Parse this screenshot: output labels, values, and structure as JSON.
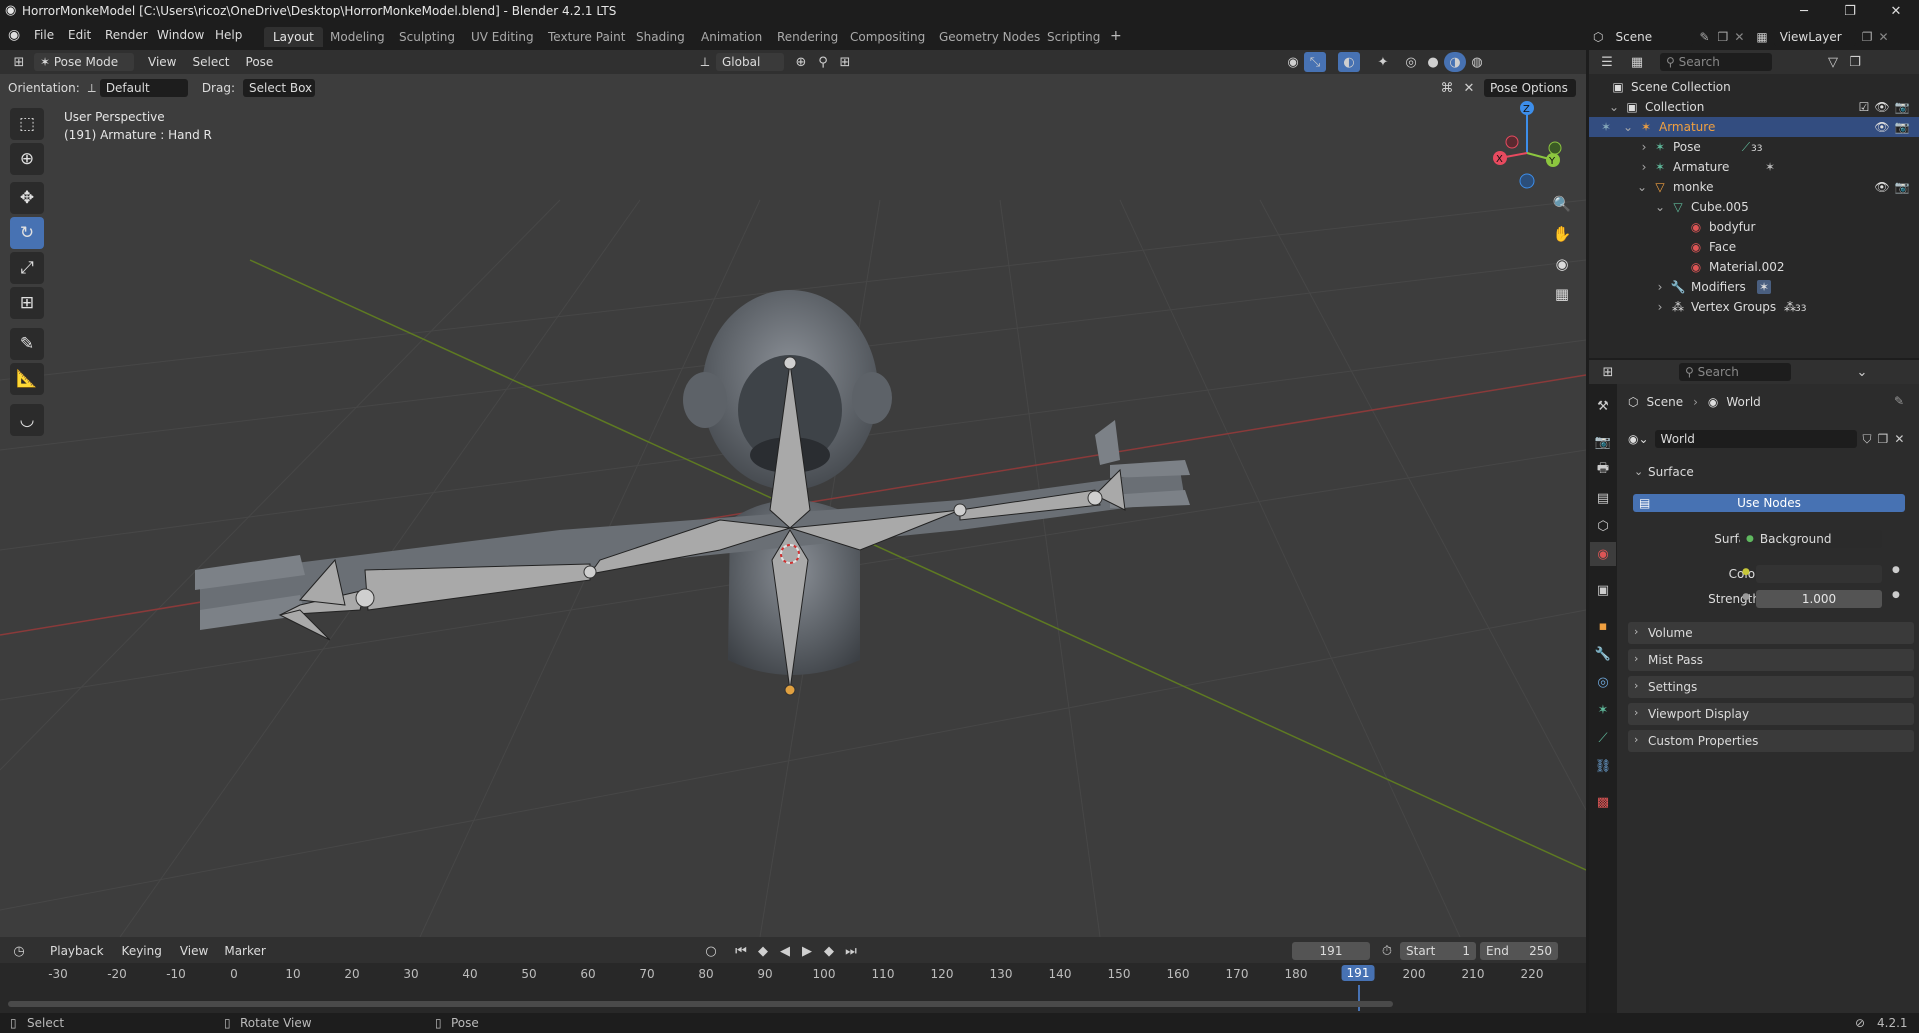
{
  "window": {
    "title": "HorrorMonkeModel [C:\\Users\\ricoz\\OneDrive\\Desktop\\HorrorMonkeModel.blend] - Blender 4.2.1 LTS",
    "minimize": "─",
    "maximize": "❐",
    "close": "✕"
  },
  "menu": {
    "file": "File",
    "edit": "Edit",
    "render": "Render",
    "window": "Window",
    "help": "Help"
  },
  "workspaces": [
    "Layout",
    "Modeling",
    "Sculpting",
    "UV Editing",
    "Texture Paint",
    "Shading",
    "Animation",
    "Rendering",
    "Compositing",
    "Geometry Nodes",
    "Scripting"
  ],
  "topright": {
    "scene": "Scene",
    "viewlayer": "ViewLayer"
  },
  "viewport_header": {
    "mode": "Pose Mode",
    "view": "View",
    "select": "Select",
    "pose": "Pose",
    "transform_orientation": "Global",
    "orientation_label": "Orientation:",
    "orientation_value": "Default",
    "drag_label": "Drag:",
    "drag_value": "Select Box",
    "pose_options": "Pose Options"
  },
  "viewport_overlay": {
    "perspective": "User Perspective",
    "object_info": "(191) Armature : Hand R"
  },
  "gizmo": {
    "x": "X",
    "y": "Y",
    "z": "Z"
  },
  "outliner": {
    "search_placeholder": "Search",
    "rows": [
      {
        "label": "Scene Collection"
      },
      {
        "label": "Collection"
      },
      {
        "label": "Armature"
      },
      {
        "label": "Pose",
        "badge": "33"
      },
      {
        "label": "Armature"
      },
      {
        "label": "monke"
      },
      {
        "label": "Cube.005"
      },
      {
        "label": "bodyfur"
      },
      {
        "label": "Face"
      },
      {
        "label": "Material.002"
      },
      {
        "label": "Modifiers"
      },
      {
        "label": "Vertex Groups",
        "badge": "33"
      }
    ]
  },
  "properties": {
    "search_placeholder": "Search",
    "breadcrumb_scene": "Scene",
    "breadcrumb_world": "World",
    "world_name": "World",
    "surface_panel": "Surface",
    "use_nodes": "Use Nodes",
    "surface_label": "Surface",
    "surface_value": "Background",
    "color_label": "Color",
    "strength_label": "Strength",
    "strength_value": "1.000",
    "panels": [
      "Volume",
      "Mist Pass",
      "Settings",
      "Viewport Display",
      "Custom Properties"
    ]
  },
  "timeline": {
    "playback": "Playback",
    "keying": "Keying",
    "view": "View",
    "marker": "Marker",
    "current_frame": "191",
    "start_label": "Start",
    "start_value": "1",
    "end_label": "End",
    "end_value": "250",
    "ticks": [
      "-30",
      "-20",
      "-10",
      "0",
      "10",
      "20",
      "30",
      "40",
      "50",
      "60",
      "70",
      "80",
      "90",
      "100",
      "110",
      "120",
      "130",
      "140",
      "150",
      "160",
      "170",
      "180",
      "191",
      "200",
      "210",
      "220"
    ]
  },
  "statusbar": {
    "select": "Select",
    "rotate_view": "Rotate View",
    "pose": "Pose",
    "version": "4.2.1"
  },
  "colors": {
    "accent_blue": "#4772b3",
    "selected_row": "#334d80",
    "axis_red": "#b23a3a",
    "axis_green": "#6b8e23",
    "gizmo_x": "#e84a5f",
    "gizmo_y": "#8cc63f",
    "gizmo_z": "#3d8eea"
  }
}
